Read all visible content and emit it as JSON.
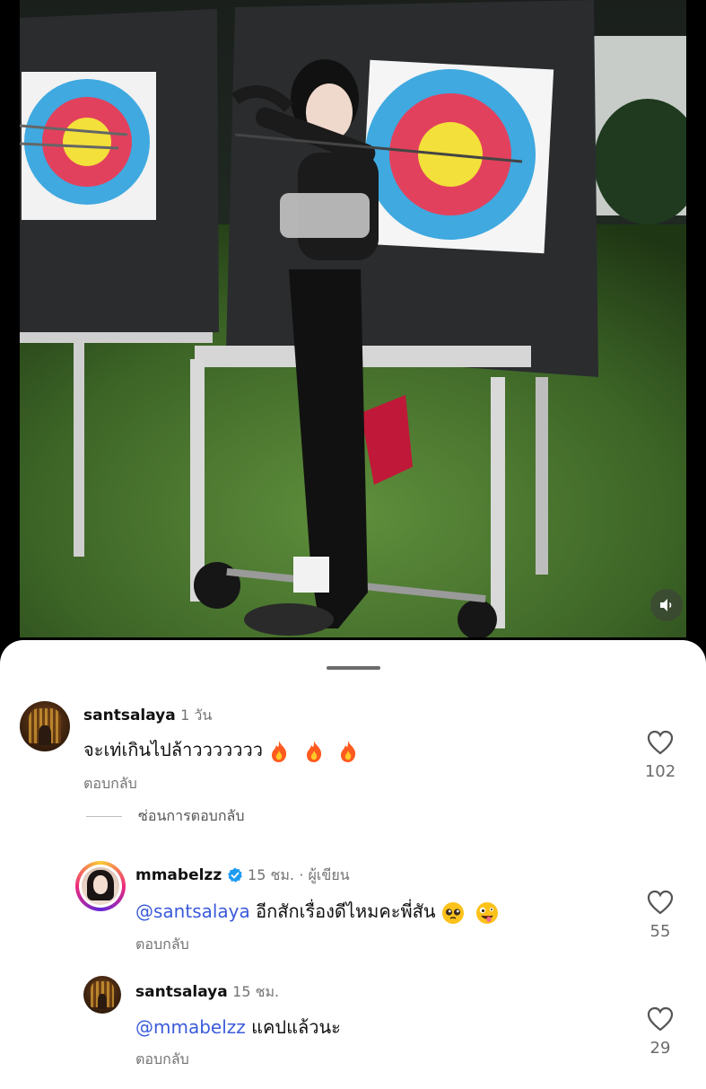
{
  "post": {
    "media_description_icon": "video-frame",
    "sound_icon": "speaker-muted-icon"
  },
  "comments": [
    {
      "username": "santsalaya",
      "time": "1 วัน",
      "text": "จะเท่เกินไปล้าววววววว",
      "emojis": [
        "fire",
        "fire",
        "fire"
      ],
      "reply_label": "ตอบกลับ",
      "likes": "102"
    },
    {
      "username": "mmabelzz",
      "verified": true,
      "time": "15 ชม.",
      "author_label": "· ผู้เขียน",
      "mention": "@santsalaya",
      "text": "อีกสักเรื่องดีไหมคะพี่สัน",
      "emojis": [
        "pleading-face",
        "zany-face"
      ],
      "reply_label": "ตอบกลับ",
      "likes": "55"
    },
    {
      "username": "santsalaya",
      "time": "15 ชม.",
      "mention": "@mmabelzz",
      "text": "แคปแล้วนะ",
      "reply_label": "ตอบกลับ",
      "likes": "29"
    }
  ],
  "hide_replies_label": "ซ่อนการตอบกลับ",
  "colors": {
    "mention": "#3b5bdb",
    "verified": "#1d9bf0",
    "meta": "#737373"
  }
}
